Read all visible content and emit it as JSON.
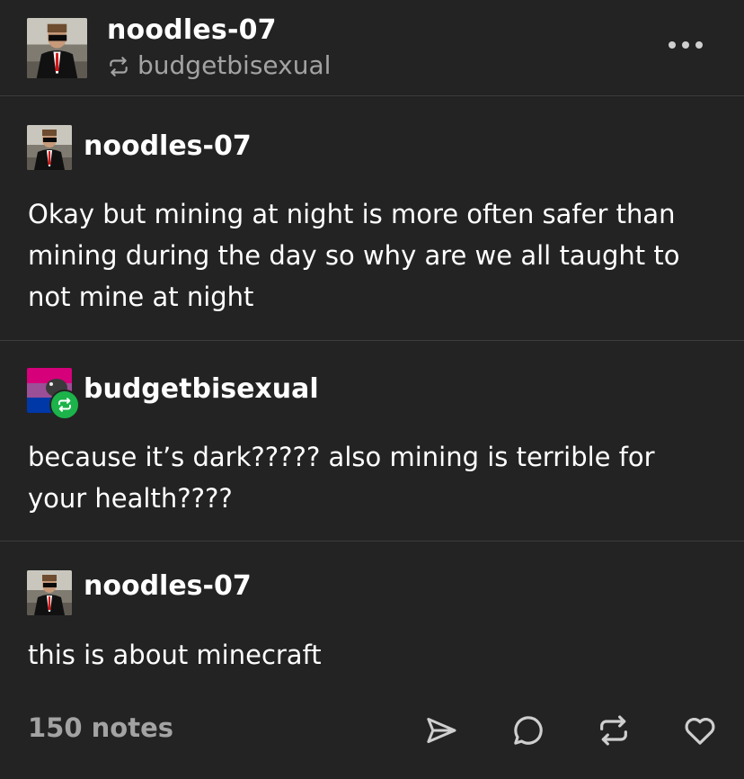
{
  "header": {
    "blog_name": "noodles-07",
    "reblogged_from": "budgetbisexual",
    "more_icon": "more-icon"
  },
  "trail": [
    {
      "blog_name": "noodles-07",
      "text": "Okay but mining at night is more often safer than mining during the day so why are we all taught to not mine at night"
    },
    {
      "blog_name": "budgetbisexual",
      "text": "because it’s dark????? also mining is terrible for your health????",
      "badge_icon": "reblog-icon"
    },
    {
      "blog_name": "noodles-07",
      "text": "this is about minecraft"
    }
  ],
  "footer": {
    "notes": "150 notes",
    "actions": [
      "share-icon",
      "reply-icon",
      "reblog-icon",
      "like-icon"
    ]
  },
  "colors": {
    "background": "#232323",
    "divider": "#3c3c3c",
    "muted_text": "#a3a3a3",
    "reblog_green": "#1bb34a"
  }
}
